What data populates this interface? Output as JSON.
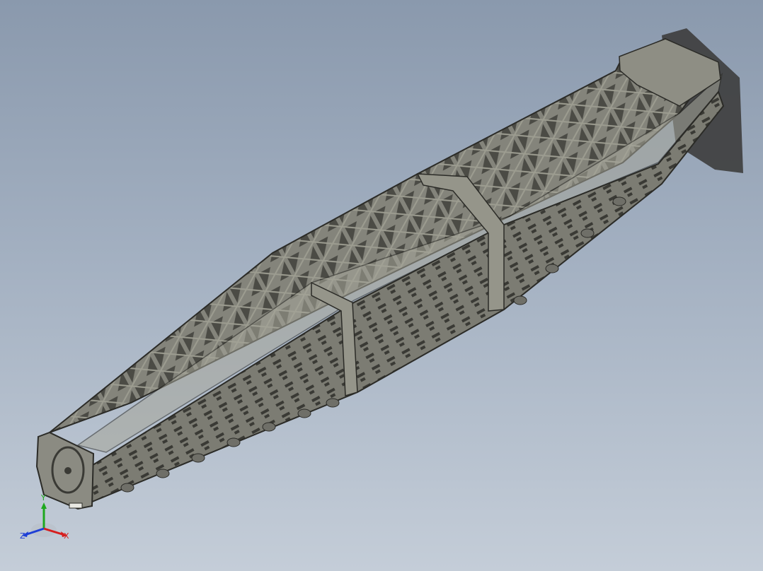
{
  "viewport": {
    "model": "fuselage-truss-frame"
  },
  "colors": {
    "background_top": "#8a99ad",
    "background_bottom": "#c4cdd8",
    "frame_face": "#84847b",
    "frame_dark": "#55554e",
    "frame_light": "#a6a69a",
    "outline": "#2b2b27",
    "shadow": "#3d3d3d",
    "axis_x": "#d61e1e",
    "axis_y": "#1ea81e",
    "axis_z": "#1e3fd6"
  },
  "triad": {
    "x_label": "X",
    "y_label": "Y",
    "z_label": "Z"
  }
}
